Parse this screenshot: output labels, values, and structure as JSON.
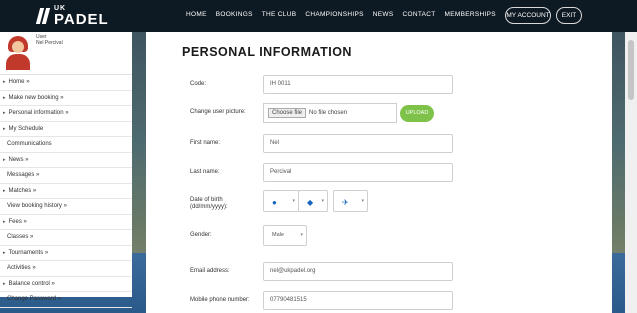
{
  "brand": {
    "small": "UK",
    "large": "PADEL"
  },
  "nav": [
    "HOME",
    "BOOKINGS",
    "THE CLUB",
    "CHAMPIONSHIPS",
    "NEWS",
    "CONTACT",
    "MEMBERSHIPS"
  ],
  "account": {
    "my_account": "MY ACCOUNT",
    "exit": "EXIT"
  },
  "profile": {
    "line1": "User",
    "line2": "Nel Percival"
  },
  "sidebar": {
    "items": [
      "Home »",
      "Make new booking »",
      "Personal information »",
      "My Schedule",
      "Communications",
      "News »",
      "Messages »",
      "Matches »",
      "View booking history »",
      "Fees »",
      "Classes »",
      "Tournaments »",
      "Activities »",
      "Balance control »",
      "Change Password »"
    ]
  },
  "page": {
    "title": "PERSONAL INFORMATION"
  },
  "form": {
    "code_label": "Code:",
    "code_value": "IH 0011",
    "picture_label": "Change user picture:",
    "choose_file": "Choose file",
    "no_file": "No file chosen",
    "upload": "UPLOAD",
    "first_name_label": "First name:",
    "first_name_value": "Nel",
    "last_name_label": "Last name:",
    "last_name_value": "Percival",
    "dob_label_1": "Date of birth",
    "dob_label_2": "(dd/mm/yyyy):",
    "gender_label": "Gender:",
    "gender_value": "Male",
    "email_label": "Email address:",
    "email_value": "nel@ukpadel.org",
    "mobile_label": "Mobile phone number:",
    "mobile_value": "07790481515"
  },
  "colors": {
    "topbar": "#0e1a23",
    "upload": "#7fc24a",
    "accent_icon": "#1565c0"
  },
  "icons": [
    "chevron-right-icon",
    "chevron-down-icon",
    "calendar-day-icon",
    "calendar-month-icon",
    "calendar-year-icon"
  ]
}
